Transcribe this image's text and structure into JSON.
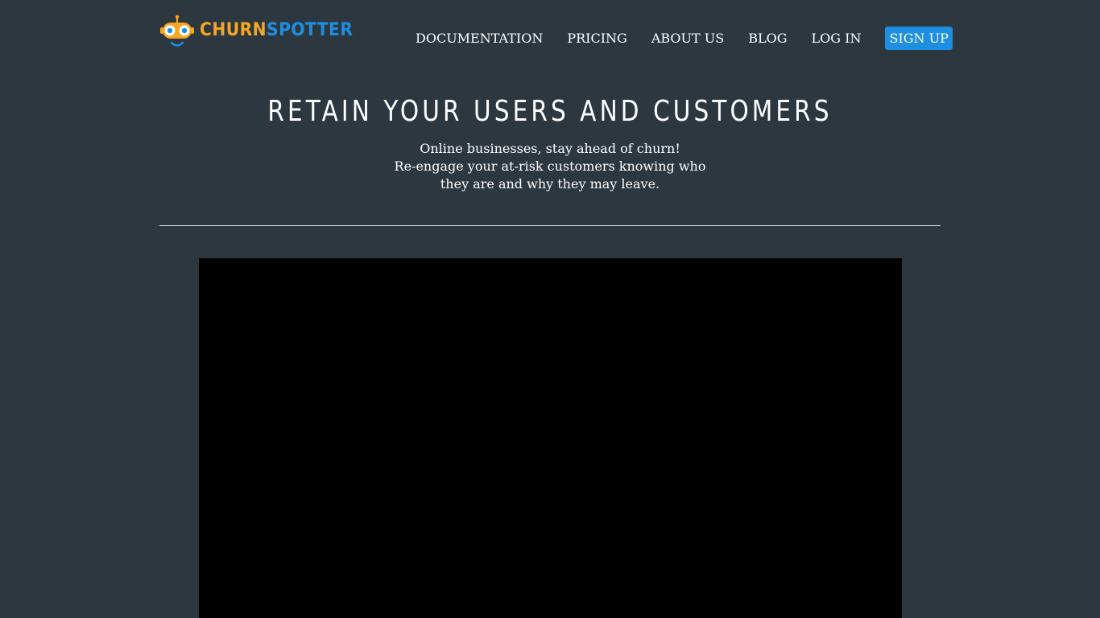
{
  "header": {
    "logo": {
      "part_a": "CHURN",
      "part_b": "SPOTTER",
      "colors": {
        "primary": "#f5a623",
        "secondary": "#1e8fe0"
      }
    },
    "nav": [
      {
        "label": "DOCUMENTATION"
      },
      {
        "label": "PRICING"
      },
      {
        "label": "ABOUT US"
      },
      {
        "label": "BLOG"
      },
      {
        "label": "LOG IN"
      }
    ],
    "signup_label": "SIGN UP"
  },
  "hero": {
    "title": "RETAIN YOUR USERS AND CUSTOMERS",
    "subtitle_lines": [
      "Online businesses, stay ahead of churn!",
      "Re-engage your at-risk customers knowing who",
      "they are and why they may leave."
    ]
  },
  "colors": {
    "background": "#2d3740",
    "accent": "#1e8fe0",
    "video_background": "#000000"
  }
}
